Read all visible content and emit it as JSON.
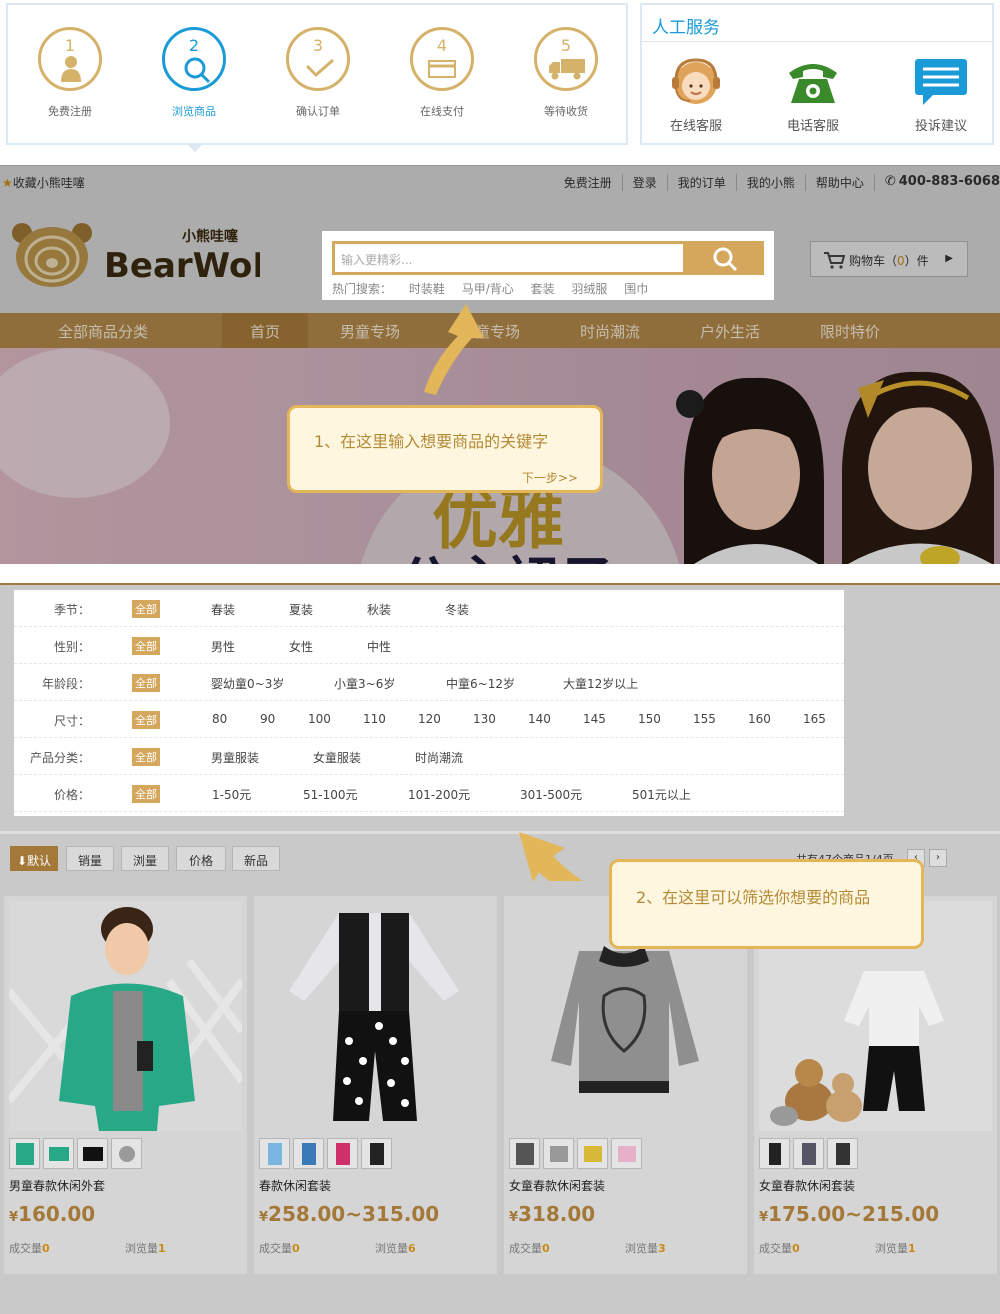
{
  "steps": [
    {
      "num": "1",
      "label": "免费注册"
    },
    {
      "num": "2",
      "label": "浏览商品"
    },
    {
      "num": "3",
      "label": "确认订单"
    },
    {
      "num": "4",
      "label": "在线支付"
    },
    {
      "num": "5",
      "label": "等待收货"
    }
  ],
  "service": {
    "title": "人工服务",
    "items": [
      {
        "label": "在线客服",
        "icon": "headset-icon"
      },
      {
        "label": "电话客服",
        "icon": "telephone-icon"
      },
      {
        "label": "投诉建议",
        "icon": "chat-bubble-icon"
      }
    ]
  },
  "topbar": {
    "favorite": "收藏小熊哇噻",
    "links": [
      "免费注册",
      "登录",
      "我的订单",
      "我的小熊",
      "帮助中心"
    ],
    "phone": "400-883-6068"
  },
  "brand": {
    "name": "BearWoN",
    "name_cn": "小熊哇噻"
  },
  "search": {
    "placeholder": "输入更精彩...",
    "hot_label": "热门搜索：",
    "hot": [
      "时装鞋",
      "马甲/背心",
      "套装",
      "羽绒服",
      "围巾"
    ]
  },
  "cart": {
    "label_pre": "购物车（",
    "count": "0",
    "label_post": "）件"
  },
  "menu": {
    "all": "全部商品分类",
    "items": [
      "首页",
      "男童专场",
      "女童专场",
      "时尚潮流",
      "户外生活",
      "限时特价"
    ]
  },
  "banner": {
    "text1": "优雅",
    "text2": "公主裙子"
  },
  "tips": {
    "tip1": "1、在这里输入想要商品的关键字",
    "tip1_next": "下一步>>",
    "tip2": "2、在这里可以筛选你想要的商品"
  },
  "filters": [
    {
      "label": "季节：",
      "all": "全部",
      "options": [
        "春装",
        "夏装",
        "秋装",
        "冬装"
      ]
    },
    {
      "label": "性别：",
      "all": "全部",
      "options": [
        "男性",
        "女性",
        "中性"
      ]
    },
    {
      "label": "年龄段：",
      "all": "全部",
      "options": [
        "婴幼童0~3岁",
        "小童3~6岁",
        "中童6~12岁",
        "大童12岁以上"
      ]
    },
    {
      "label": "尺寸：",
      "all": "全部",
      "options": [
        "80",
        "90",
        "100",
        "110",
        "120",
        "130",
        "140",
        "145",
        "150",
        "155",
        "160",
        "165"
      ]
    },
    {
      "label": "产品分类：",
      "all": "全部",
      "options": [
        "男童服装",
        "女童服装",
        "时尚潮流"
      ]
    },
    {
      "label": "价格：",
      "all": "全部",
      "options": [
        "1-50元",
        "51-100元",
        "101-200元",
        "301-500元",
        "501元以上"
      ]
    }
  ],
  "sort": {
    "buttons": [
      "默认",
      "销量",
      "浏量",
      "价格",
      "新品"
    ],
    "summary": "共有47个商品1/4页",
    "prev": "‹",
    "next": "›"
  },
  "products": [
    {
      "name": "男童春款休闲外套",
      "currency": "¥",
      "price": "160.00",
      "sold_label": "成交量",
      "sold": "0",
      "views_label": "浏览量",
      "views": "1"
    },
    {
      "name": "春款休闲套装",
      "currency": "¥",
      "price": "258.00~315.00",
      "sold_label": "成交量",
      "sold": "0",
      "views_label": "浏览量",
      "views": "6"
    },
    {
      "name": "女童春款休闲套装",
      "currency": "¥",
      "price": "318.00",
      "sold_label": "成交量",
      "sold": "0",
      "views_label": "浏览量",
      "views": "3"
    },
    {
      "name": "女童春款休闲套装",
      "currency": "¥",
      "price": "175.00~215.00",
      "sold_label": "成交量",
      "sold": "0",
      "views_label": "浏览量",
      "views": "1"
    }
  ],
  "colors": {
    "accent": "#d4a75c",
    "brand_brown": "#a47839",
    "blue": "#1a9ad6",
    "green": "#3a8a2b"
  }
}
